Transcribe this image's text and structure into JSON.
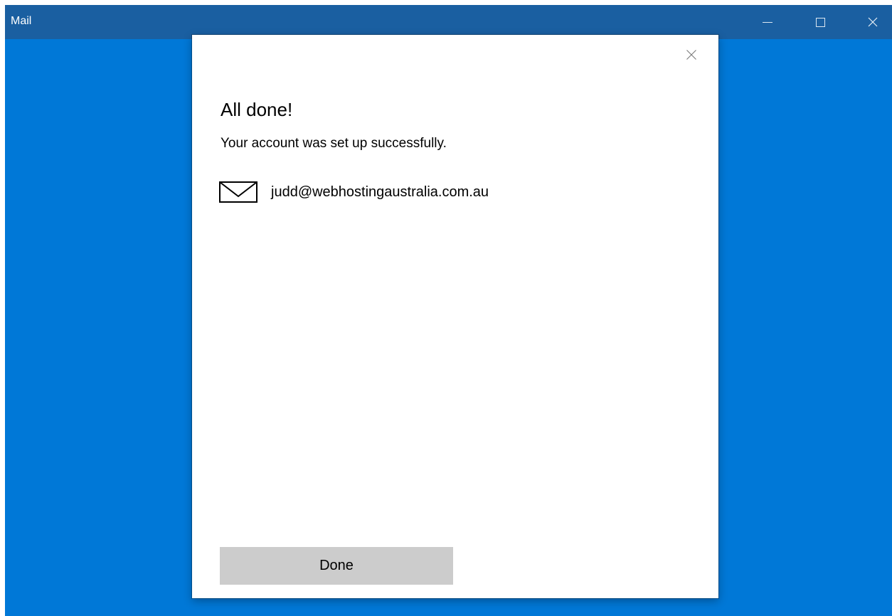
{
  "window": {
    "title": "Mail",
    "accent_color": "#0078d7",
    "titlebar_color": "#1a5fa1",
    "controls": {
      "minimize_icon": "minimize-icon",
      "maximize_icon": "maximize-icon",
      "close_icon": "close-icon"
    }
  },
  "dialog": {
    "close_icon": "close-icon",
    "title": "All done!",
    "subtitle": "Your account was set up successfully.",
    "account": {
      "icon": "mail-envelope-icon",
      "email": "judd@webhostingaustralia.com.au"
    },
    "done_label": "Done",
    "done_button_color": "#cccccc"
  }
}
